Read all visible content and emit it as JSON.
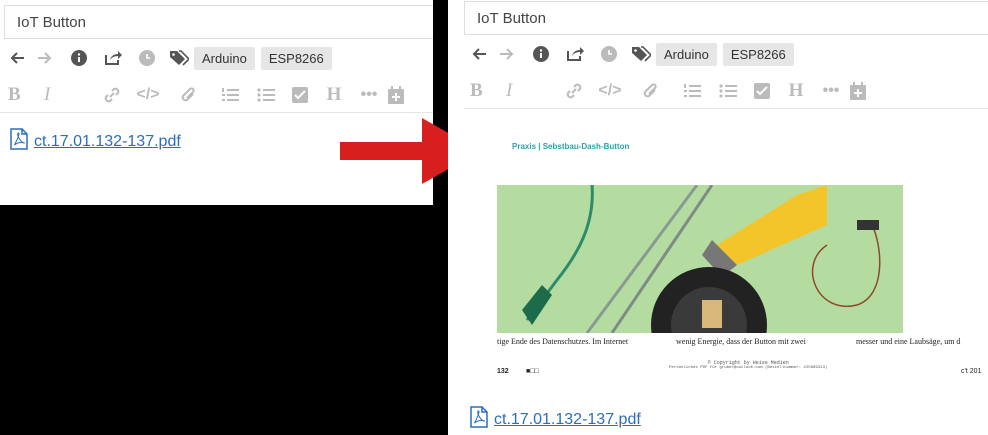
{
  "note": {
    "title": "IoT Button",
    "tags": [
      "Arduino",
      "ESP8266"
    ],
    "attachment": "ct.17.01.132-137.pdf"
  },
  "toolbar": {
    "icons": [
      "back-icon",
      "forward-icon",
      "info-icon",
      "share-icon",
      "reminder-icon",
      "tags-icon"
    ]
  },
  "format_toolbar": {
    "icons": [
      "bold-icon",
      "italic-icon",
      "link-icon",
      "code-icon",
      "attach-icon",
      "numbered-list-icon",
      "bullet-list-icon",
      "checkbox-icon",
      "heading-icon",
      "more-icon",
      "insert-date-icon"
    ]
  },
  "pdf_preview": {
    "header": "Praxis | Sebstbau-Dash-Button",
    "text_col1": "tige Ende des Datenschutzes. Im Internet",
    "text_col2": "wenig Energie, dass der Button mit zwei",
    "text_col3": "messer und eine Laubsäge, um d",
    "copyright": "© Copyright by Heise Medien",
    "copyright_sub": "Persönliches PDF für gruber@outlook.com (Bestellnummer: 225969313)",
    "page_number": "132",
    "page_right": "c't 201",
    "page_boxes": "■□□"
  },
  "colors": {
    "link": "#2a6ebb",
    "arrow": "#d81f1f",
    "header_teal": "#2aa3a6",
    "photo_bg": "#b5dca0"
  }
}
